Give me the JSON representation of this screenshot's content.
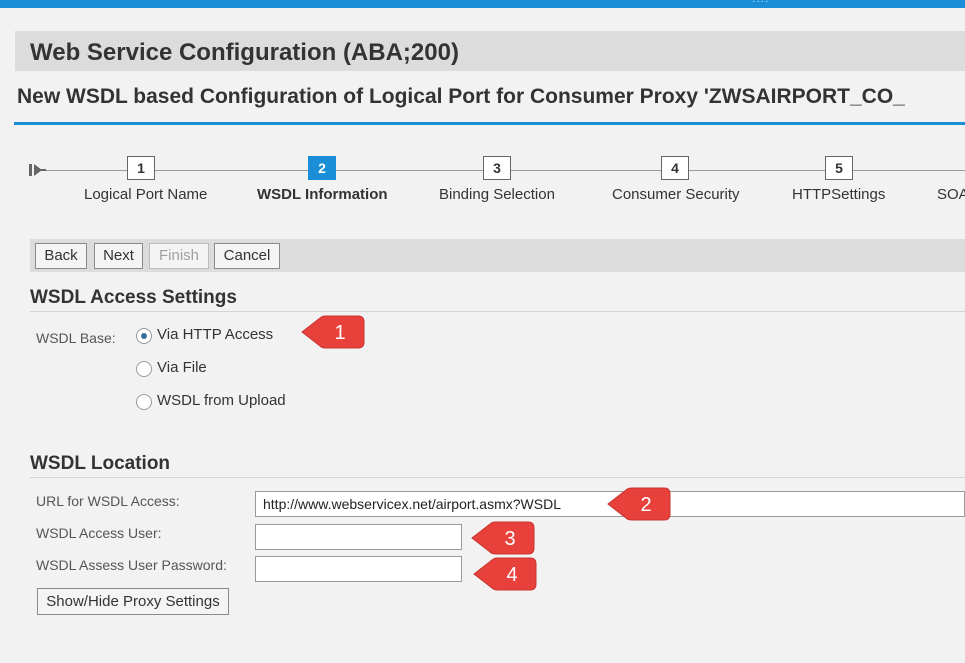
{
  "header": {
    "app_title": "Web Service Configuration (ABA;200)",
    "subtitle": "New WSDL based Configuration of Logical Port for Consumer Proxy 'ZWSAIRPORT_CO_",
    "accent": "#1a8ed6"
  },
  "roadmap": {
    "steps": [
      {
        "num": "1",
        "label": "Logical Port Name"
      },
      {
        "num": "2",
        "label": "WSDL Information"
      },
      {
        "num": "3",
        "label": "Binding Selection"
      },
      {
        "num": "4",
        "label": "Consumer Security"
      },
      {
        "num": "5",
        "label": "HTTPSettings"
      },
      {
        "label": "SOA"
      }
    ]
  },
  "toolbar": {
    "back": "Back",
    "next": "Next",
    "finish": "Finish",
    "cancel": "Cancel"
  },
  "access": {
    "title": "WSDL Access Settings",
    "base_label": "WSDL Base:",
    "options": [
      "Via HTTP Access",
      "Via File",
      "WSDL from Upload"
    ],
    "selected": "Via HTTP Access"
  },
  "location": {
    "title": "WSDL Location",
    "url_label": "URL for WSDL Access:",
    "url_value": "http://www.webservicex.net/airport.asmx?WSDL",
    "user_label": "WSDL Access User:",
    "user_value": "",
    "password_label": "WSDL Assess User Password:",
    "password_value": "",
    "proxy_button": "Show/Hide Proxy Settings"
  },
  "annotations": {
    "badges": [
      "1",
      "2",
      "3",
      "4"
    ],
    "color": "#e8413c"
  }
}
